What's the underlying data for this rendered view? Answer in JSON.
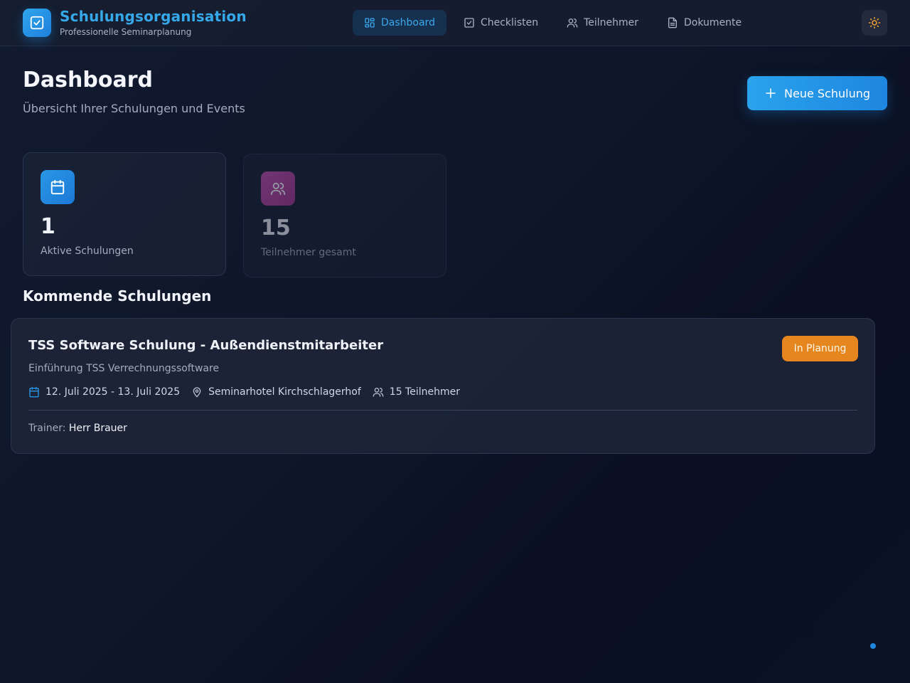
{
  "header": {
    "app_title": "Schulungsorganisation",
    "app_subtitle": "Professionelle Seminarplanung",
    "logo_icon": "checkbox-icon",
    "nav": [
      {
        "label": "Dashboard",
        "icon": "dashboard-icon",
        "active": true
      },
      {
        "label": "Checklisten",
        "icon": "checklist-icon",
        "active": false
      },
      {
        "label": "Teilnehmer",
        "icon": "users-icon",
        "active": false
      },
      {
        "label": "Dokumente",
        "icon": "document-icon",
        "active": false
      }
    ],
    "theme_toggle_icon": "sun-icon"
  },
  "page": {
    "title": "Dashboard",
    "subtitle": "Übersicht Ihrer Schulungen und Events",
    "primary_button": {
      "label": "Neue Schulung",
      "icon": "plus-icon"
    }
  },
  "stats": [
    {
      "value": "1",
      "label": "Aktive Schulungen",
      "icon": "calendar-icon",
      "color": "#1f86e0"
    },
    {
      "value": "15",
      "label": "Teilnehmer gesamt",
      "icon": "users-icon",
      "color": "#b0409c"
    }
  ],
  "upcoming": {
    "title": "Kommende Schulungen",
    "events": [
      {
        "title": "TSS Software Schulung - Außendienstmitarbeiter",
        "description": "Einführung TSS Verrechnungssoftware",
        "dates": "12. Juli 2025 - 13. Juli 2025",
        "location": "Seminarhotel Kirchschlagerhof",
        "participants": "15 Teilnehmer",
        "trainer_label": "Trainer:",
        "trainer": "Herr Brauer",
        "status": "In Planung",
        "status_color": "#e5861f"
      }
    ]
  },
  "colors": {
    "accent": "#2aa3ec",
    "background": "#0f1629"
  }
}
